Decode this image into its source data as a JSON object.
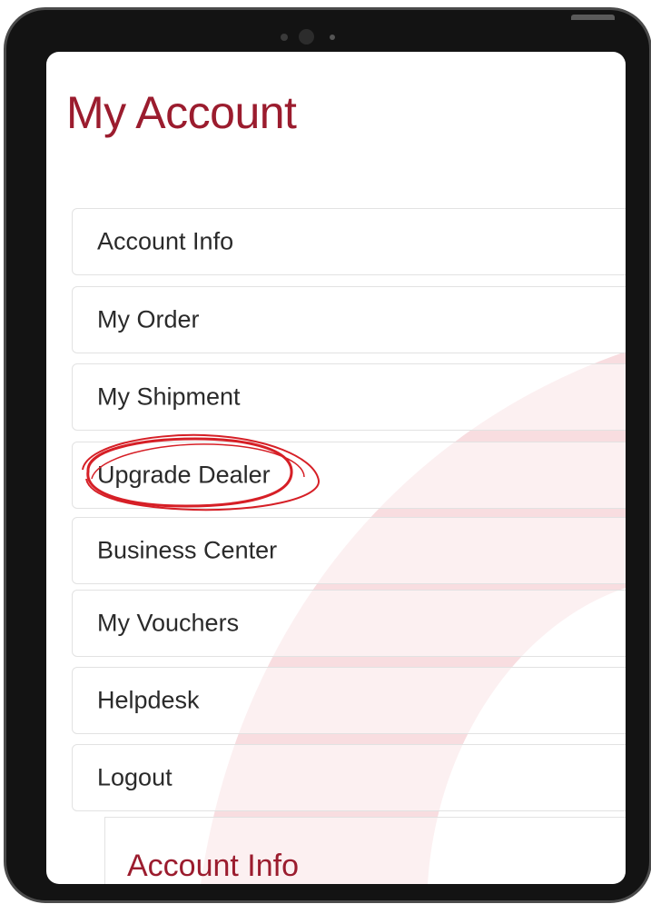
{
  "page": {
    "title": "My Account"
  },
  "menu": {
    "items": [
      {
        "label": "Account Info"
      },
      {
        "label": "My Order"
      },
      {
        "label": "My Shipment"
      },
      {
        "label": "Upgrade Dealer",
        "annotated": true
      },
      {
        "label": "Business Center"
      },
      {
        "label": "My Vouchers"
      },
      {
        "label": "Helpdesk"
      },
      {
        "label": "Logout"
      }
    ]
  },
  "section": {
    "title": "Account Info"
  },
  "colors": {
    "title": "#9b1c2e",
    "text": "#2a2a2a",
    "border": "#e2e2e2",
    "annotation": "#d61f26",
    "background_shape": "#f8dde0",
    "device_frame": "#131313"
  },
  "icons": {
    "annotation": "hand-drawn-circle-icon"
  }
}
